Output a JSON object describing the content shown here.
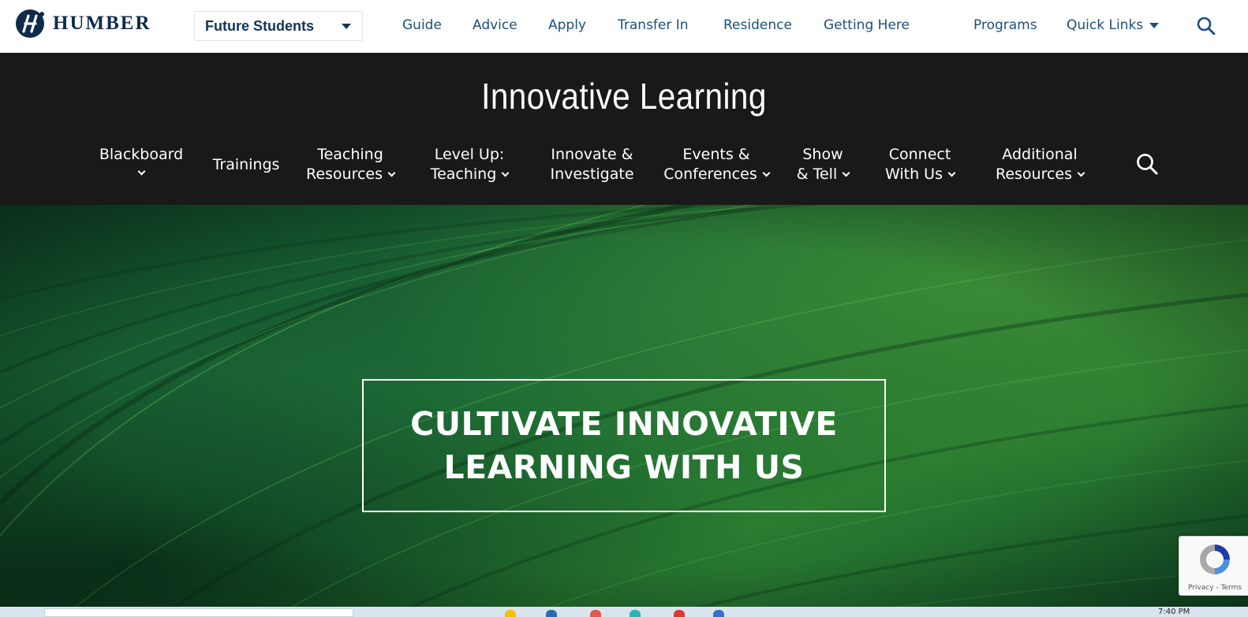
{
  "topbar": {
    "brand": "HUMBER",
    "audience_selected": "Future Students",
    "links": [
      "Guide",
      "Advice",
      "Apply",
      "Transfer In",
      "Residence",
      "Getting Here"
    ],
    "programs": "Programs",
    "quick_links": "Quick Links"
  },
  "section": {
    "title": "Innovative Learning",
    "nav": [
      {
        "line1": "Blackboard",
        "line2": ""
      },
      {
        "line1": "Trainings",
        "line2": ""
      },
      {
        "line1": "Teaching",
        "line2": "Resources"
      },
      {
        "line1": "Level Up:",
        "line2": "Teaching"
      },
      {
        "line1": "Innovate &",
        "line2": "Investigate"
      },
      {
        "line1": "Events &",
        "line2": "Conferences"
      },
      {
        "line1": "Show",
        "line2": "& Tell"
      },
      {
        "line1": "Connect",
        "line2": "With Us"
      },
      {
        "line1": "Additional",
        "line2": "Resources"
      }
    ]
  },
  "hero": {
    "line1": "CULTIVATE INNOVATIVE",
    "line2": "LEARNING WITH US"
  },
  "recaptcha": {
    "privacy": "Privacy",
    "separator": "-",
    "terms": "Terms"
  },
  "taskbar": {
    "clock": "7:40 PM"
  },
  "colors": {
    "brand_navy": "#0f2a4a",
    "link_blue": "#1c4f7c",
    "dark_header": "#191919",
    "hero_green": "#1d6a36"
  },
  "icons": {
    "top_search": "search-icon",
    "nav_search": "search-icon",
    "dropdown": "chevron-down-icon",
    "caret": "caret-down-icon",
    "recaptcha": "recaptcha-icon"
  }
}
